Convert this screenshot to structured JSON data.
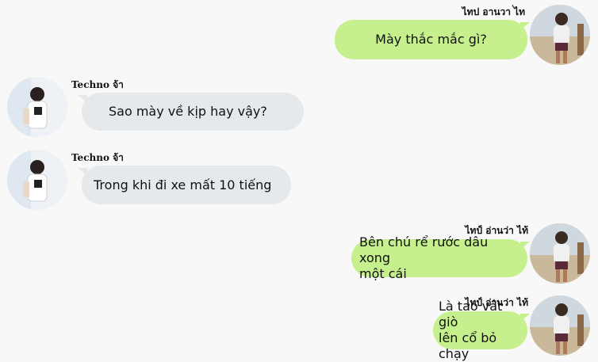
{
  "messages": [
    {
      "sender": "ไทป อานวา ่ไท",
      "text": "Mày thắc mắc gì?"
    },
    {
      "sender": "Techno จ้า",
      "text": "Sao mày về kịp hay vậy?"
    },
    {
      "sender": "Techno จ้า",
      "text": "Trong khi đi xe mất 10 tiếng"
    },
    {
      "sender": "ไทป์ อ่านว่า ไท้",
      "text_line1": "Bên chú rể rước dâu xong",
      "text_line2": "một cái"
    },
    {
      "sender": "ไทป์ อ่านว่า ไท้",
      "text_line1": "Là tao vắt giò",
      "text_line2": "lên cổ bỏ chạy"
    }
  ],
  "colors": {
    "outgoing_bubble": "#c6f08d",
    "incoming_bubble": "#e6e9ec",
    "background": "#f8f8f8"
  }
}
